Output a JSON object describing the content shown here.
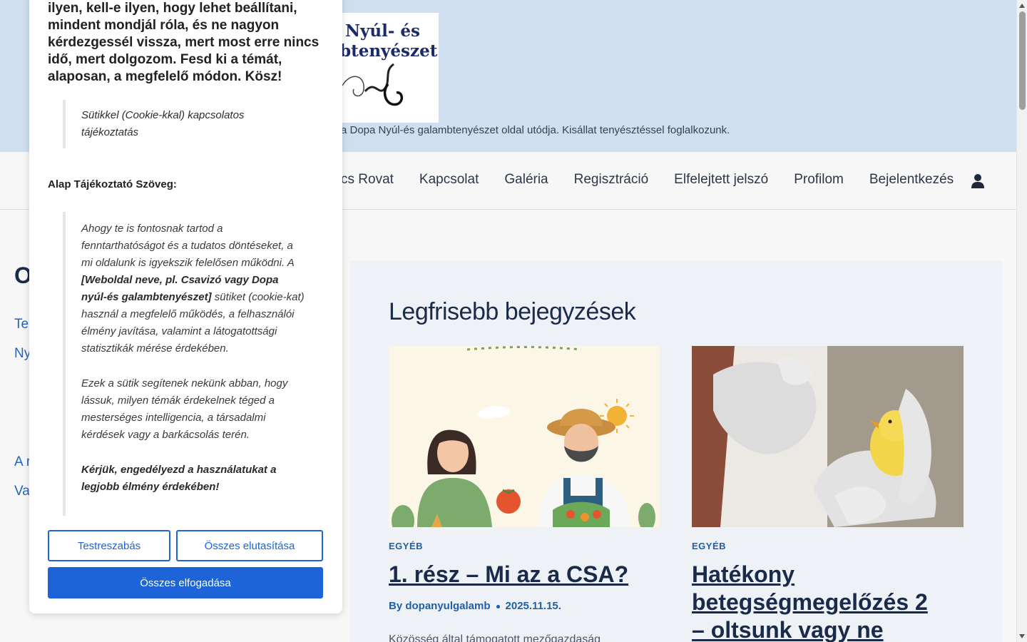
{
  "header": {
    "logo_line1": "Nyúl- és",
    "logo_line2": "btenyészet",
    "tagline": "a Dopa Nyúl-és galambtenyészet oldal utódja. Kisállat tenyésztéssel foglalkozunk."
  },
  "nav": {
    "items": [
      {
        "label": "cs Rovat"
      },
      {
        "label": "Kapcsolat"
      },
      {
        "label": "Galéria"
      },
      {
        "label": "Regisztráció"
      },
      {
        "label": "Elfelejtett jelszó"
      },
      {
        "label": "Profilom"
      },
      {
        "label": "Bejelentkezés"
      }
    ],
    "user_icon": "user-icon"
  },
  "sidebar": {
    "heading": "O",
    "links": [
      "Te",
      "Ny",
      "A r",
      "Va"
    ]
  },
  "main": {
    "section_title": "Legfrisebb bejegyzések",
    "posts": [
      {
        "category": "EGYÉB",
        "title": "1. rész – Mi az a CSA?",
        "author": "By dopanyulgalamb",
        "date": "2025.11.15.",
        "excerpt": "Közösség által támogatott mezőgazdaság"
      },
      {
        "category": "EGYÉB",
        "title_line1": "Hatékony",
        "title_line2": "betegségmegelőzés 2",
        "title_line3": "– oltsunk vagy ne"
      }
    ]
  },
  "cookie": {
    "intro": "ilyen, kell-e ilyen, hogy lehet beállítani, mindent mondjál róla, és ne nagyon kérdezgessél vissza, mert most erre nincs idő, mert dolgozom. Fesd ki a témát, alaposan, a megfelelő módon. Kösz!",
    "quote1": "Sütikkel (Cookie-kkal) kapcsolatos tájékoztatás",
    "subheading": "Alap Tájékoztató Szöveg:",
    "para1_a": "Ahogy te is fontosnak tartod a fenntarthatóságot és a tudatos döntéseket, a mi oldalunk is igyekszik felelősen működni. A ",
    "para1_b": "[Weboldal neve, pl. Csavizó vagy Dopa nyúl-és galambtenyészet]",
    "para1_c": " sütiket (cookie-kat) használ a megfelelő működés, a felhasználói élmény javítása, valamint a látogatottsági statisztikák mérése érdekében.",
    "para2": "Ezek a sütik segítenek nekünk abban, hogy lássuk, milyen témák érdekelnek téged a mesterséges intelligencia, a társadalmi kérdések vagy a barkácsolás terén.",
    "para3": "Kérjük, engedélyezd a használatukat a legjobb élmény érdekében!",
    "btn_customize": "Testreszabás",
    "btn_reject": "Összes elutasítása",
    "btn_accept": "Összes elfogadása"
  },
  "colors": {
    "header_bg": "#cfdff0",
    "accent_blue": "#1c64d8",
    "link_blue": "#2563b8",
    "title_dark": "#1a2b4a"
  }
}
